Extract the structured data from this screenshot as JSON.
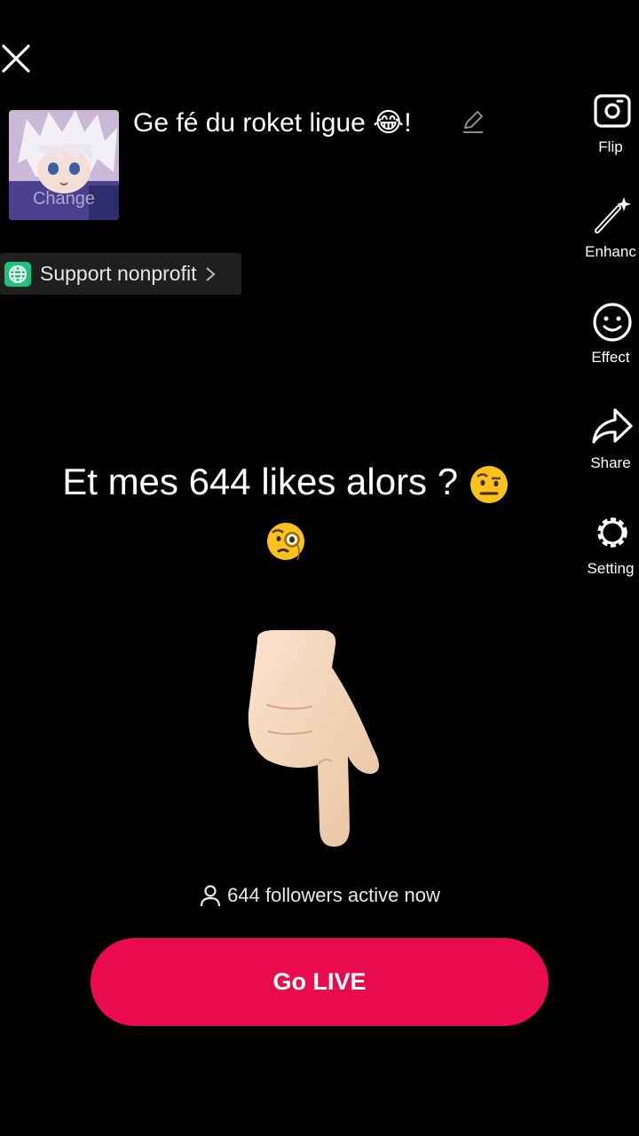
{
  "header": {
    "close_icon": "close-icon"
  },
  "cover": {
    "change_label": "Change",
    "image": "anime-avatar"
  },
  "title": {
    "text": "Ge fé du roket ligue 😂!",
    "edit_icon": "pencil-icon"
  },
  "nonprofit": {
    "label": "Support nonprofit",
    "icon": "globe-icon",
    "chevron": "chevron-right-icon"
  },
  "tools": [
    {
      "label": "Flip",
      "icon": "flip-camera-icon"
    },
    {
      "label": "Enhanc",
      "icon": "magic-wand-icon"
    },
    {
      "label": "Effect",
      "icon": "smiley-icon"
    },
    {
      "label": "Share",
      "icon": "share-arrow-icon"
    },
    {
      "label": "Setting",
      "icon": "gear-icon"
    }
  ],
  "overlay": {
    "line1": "Et mes 644 likes alors ?",
    "line1_emoji": "raised-eyebrow-emoji",
    "line2_emoji": "monocle-face-emoji",
    "hand_emoji": "pointing-down-hand-emoji"
  },
  "followers": {
    "icon": "person-icon",
    "text": "644 followers active now"
  },
  "go_live": {
    "label": "Go LIVE"
  },
  "colors": {
    "background": "#000000",
    "accent": "#ea0b4e"
  }
}
